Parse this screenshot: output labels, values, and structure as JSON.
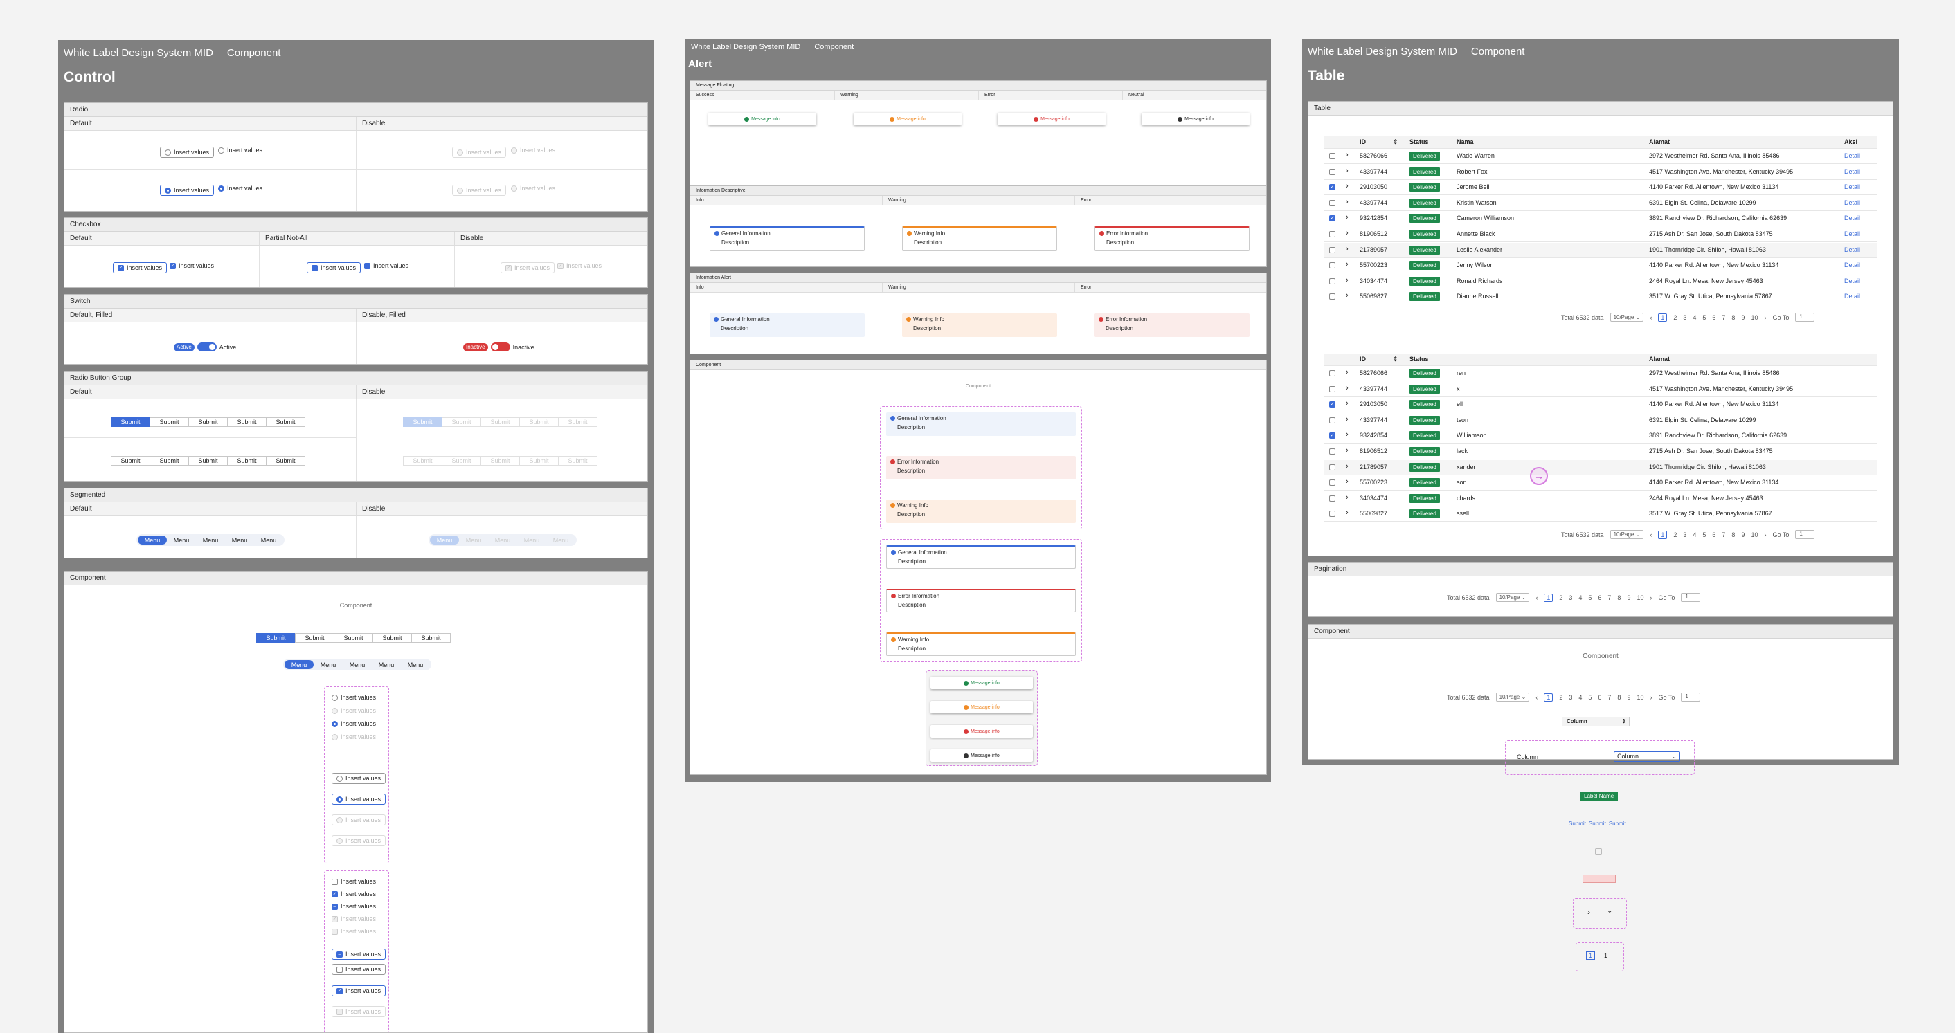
{
  "header": {
    "brand": "White Label Design System MID",
    "crumb": "Component"
  },
  "control": {
    "title": "Control",
    "radio": {
      "title": "Radio",
      "default": "Default",
      "disable": "Disable",
      "label": "Insert values"
    },
    "checkbox": {
      "title": "Checkbox",
      "default": "Default",
      "partial": "Partial Not-All",
      "disable": "Disable",
      "label": "Insert values"
    },
    "switch": {
      "title": "Switch",
      "default": "Default, Filled",
      "disable": "Disable, Filled",
      "active": "Active",
      "inactive": "Inactive"
    },
    "rbg": {
      "title": "Radio Button Group",
      "default": "Default",
      "disable": "Disable",
      "btn": "Submit"
    },
    "segmented": {
      "title": "Segmented",
      "default": "Default",
      "disable": "Disable",
      "item": "Menu"
    },
    "component": {
      "title": "Component",
      "caption": "Component",
      "btn": "Submit",
      "item": "Menu",
      "label": "Insert values"
    }
  },
  "alert": {
    "title": "Alert",
    "floating": {
      "title": "Message Floating",
      "cols": [
        "Success",
        "Warning",
        "Error",
        "Neutral"
      ],
      "msg": "Message info"
    },
    "descriptive": {
      "title": "Information Descriptive",
      "cols": [
        "Info",
        "Warning",
        "Error"
      ]
    },
    "infoalert": {
      "title": "Information Alert",
      "cols": [
        "Info",
        "Warning",
        "Error"
      ]
    },
    "items": {
      "info": "General Information",
      "warn": "Warning Info",
      "err": "Error Information",
      "desc": "Description"
    },
    "component": {
      "title": "Component",
      "caption": "Component"
    }
  },
  "table": {
    "title": "Table",
    "section": "Table",
    "cols": {
      "id": "ID",
      "status": "Status",
      "name": "Nama",
      "address": "Alamat",
      "action": "Aksi"
    },
    "status": "Delivered",
    "action": "Detail",
    "rows": [
      {
        "id": "58276066",
        "name": "Wade Warren",
        "frag": "ren",
        "addr": "2972 Westheimer Rd. Santa Ana, Illinois 85486",
        "checked": false
      },
      {
        "id": "43397744",
        "name": "Robert Fox",
        "frag": "x",
        "addr": "4517 Washington Ave. Manchester, Kentucky 39495",
        "checked": false
      },
      {
        "id": "29103050",
        "name": "Jerome Bell",
        "frag": "ell",
        "addr": "4140 Parker Rd. Allentown, New Mexico 31134",
        "checked": true
      },
      {
        "id": "43397744",
        "name": "Kristin Watson",
        "frag": "tson",
        "addr": "6391 Elgin St. Celina, Delaware 10299",
        "checked": false
      },
      {
        "id": "93242854",
        "name": "Cameron Williamson",
        "frag": "Williamson",
        "addr": "3891 Ranchview Dr. Richardson, California 62639",
        "checked": true
      },
      {
        "id": "81906512",
        "name": "Annette Black",
        "frag": "lack",
        "addr": "2715 Ash Dr. San Jose, South Dakota 83475",
        "checked": false
      },
      {
        "id": "21789057",
        "name": "Leslie Alexander",
        "frag": "xander",
        "addr": "1901 Thornridge Cir. Shiloh, Hawaii 81063",
        "checked": false
      },
      {
        "id": "55700223",
        "name": "Jenny Wilson",
        "frag": "son",
        "addr": "4140 Parker Rd. Allentown, New Mexico 31134",
        "checked": false
      },
      {
        "id": "34034474",
        "name": "Ronald Richards",
        "frag": "chards",
        "addr": "2464 Royal Ln. Mesa, New Jersey 45463",
        "checked": false
      },
      {
        "id": "55069827",
        "name": "Dianne Russell",
        "frag": "ssell",
        "addr": "3517 W. Gray St. Utica, Pennsylvania 57867",
        "checked": false
      }
    ],
    "pagination": {
      "title": "Pagination",
      "total": "Total 6532 data",
      "per": "10/Page",
      "pages": [
        "1",
        "2",
        "3",
        "4",
        "5",
        "6",
        "7",
        "8",
        "9",
        "10"
      ],
      "goto": "Go To",
      "goval": "1"
    },
    "component": {
      "title": "Component",
      "caption": "Component",
      "column": "Column",
      "label": "Label Name",
      "btn": "Submit"
    }
  },
  "colors": {
    "accent": "#3b6bd8",
    "success": "#1f8a4c",
    "error": "#d93a3a",
    "warning": "#f08a24",
    "board": "#808080"
  }
}
